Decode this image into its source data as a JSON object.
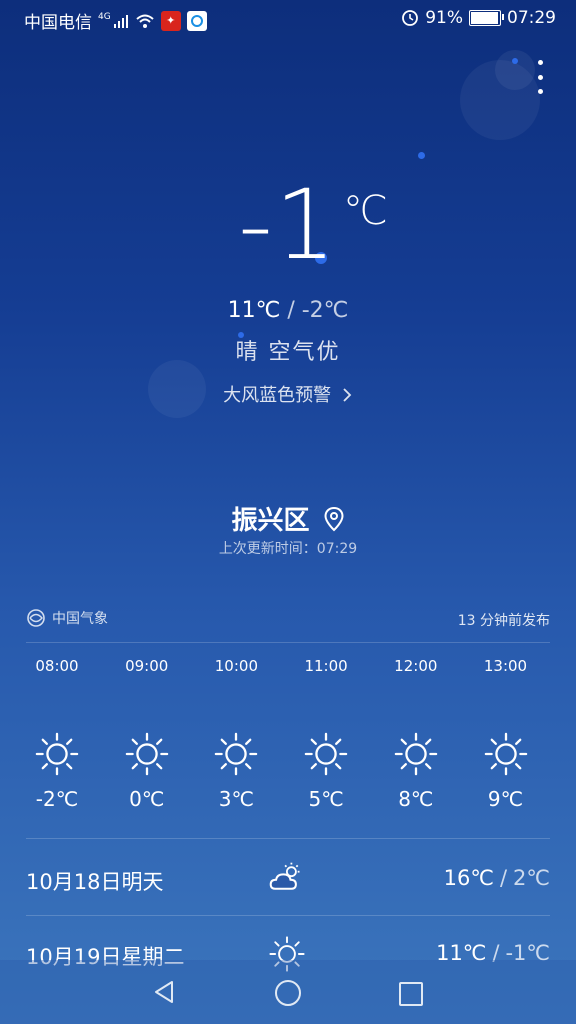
{
  "status_bar": {
    "carrier": "中国电信",
    "network": "4G",
    "battery": "91%",
    "battery_level": 0.91,
    "time": "07:29"
  },
  "current": {
    "temp": "-1",
    "unit": "℃",
    "high": "11℃",
    "separator": "/",
    "low": "-2℃",
    "condition": "晴",
    "air_quality": "空气优",
    "alert": "大风蓝色预警"
  },
  "location": {
    "name": "振兴区",
    "updated": "上次更新时间：07:29"
  },
  "source": {
    "name": "中国气象",
    "published": "13 分钟前发布"
  },
  "hourly": [
    {
      "time": "08:00",
      "icon": "sun-icon",
      "temp": "-2℃"
    },
    {
      "time": "09:00",
      "icon": "sun-icon",
      "temp": "0℃"
    },
    {
      "time": "10:00",
      "icon": "sun-icon",
      "temp": "3℃"
    },
    {
      "time": "11:00",
      "icon": "sun-icon",
      "temp": "5℃"
    },
    {
      "time": "12:00",
      "icon": "sun-icon",
      "temp": "8℃"
    },
    {
      "time": "13:00",
      "icon": "sun-icon",
      "temp": "9℃"
    }
  ],
  "daily": [
    {
      "date": "10月18日明天",
      "icon": "partly-cloudy-icon",
      "high": "16℃",
      "low": "2℃"
    },
    {
      "date": "10月19日星期二",
      "icon": "sun-icon",
      "high": "11℃",
      "low": "-1℃"
    }
  ],
  "colors": {
    "bg_top": "#0d2e7c",
    "bg_bottom": "#3c76bd"
  }
}
